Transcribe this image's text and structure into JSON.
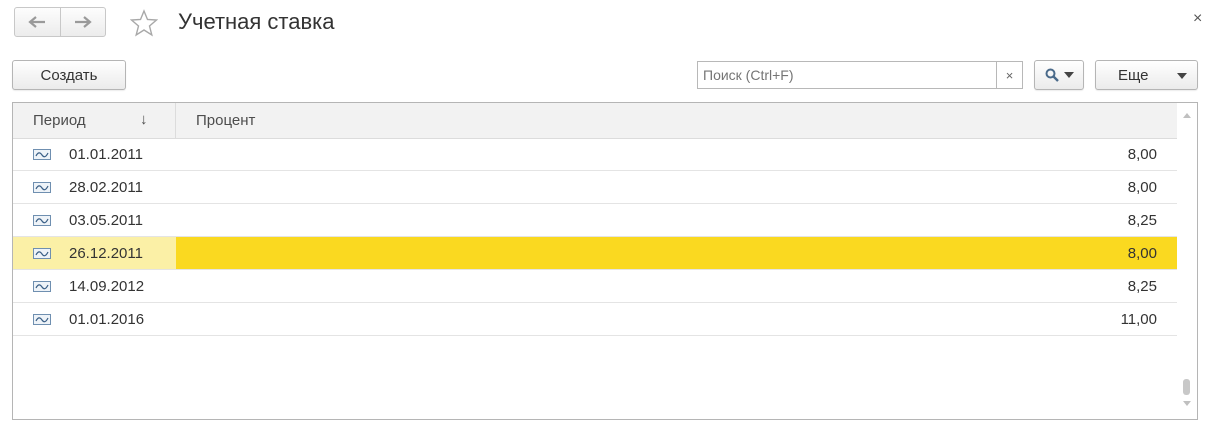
{
  "window": {
    "title": "Учетная ставка",
    "close_label": "×"
  },
  "nav": {
    "back_icon": "arrow-left-icon",
    "forward_icon": "arrow-right-icon",
    "favorite_icon": "star-icon"
  },
  "toolbar": {
    "create_label": "Создать",
    "search_placeholder": "Поиск (Ctrl+F)",
    "search_clear_label": "×",
    "search_icon": "magnifier-icon",
    "more_label": "Еще"
  },
  "table": {
    "columns": {
      "period": "Период",
      "percent": "Процент"
    },
    "sort_indicator": "↓",
    "rows": [
      {
        "date": "01.01.2011",
        "value": "8,00",
        "selected": false
      },
      {
        "date": "28.02.2011",
        "value": "8,00",
        "selected": false
      },
      {
        "date": "03.05.2011",
        "value": "8,25",
        "selected": false
      },
      {
        "date": "26.12.2011",
        "value": "8,00",
        "selected": true
      },
      {
        "date": "14.09.2012",
        "value": "8,25",
        "selected": false
      },
      {
        "date": "01.01.2016",
        "value": "11,00",
        "selected": false
      }
    ]
  },
  "colors": {
    "selected_row": "#fad920",
    "selected_row_left": "#fbf0a6",
    "header_bg": "#f2f2f2"
  }
}
